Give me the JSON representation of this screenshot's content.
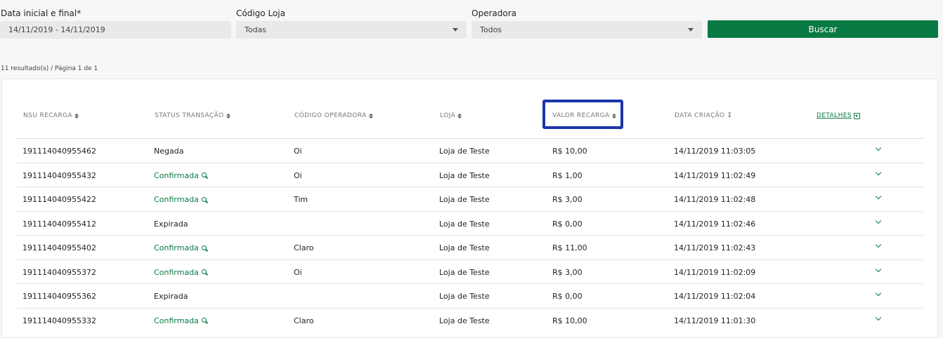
{
  "filters": {
    "date": {
      "label": "Data inicial e final*",
      "value": "14/11/2019 - 14/11/2019"
    },
    "store": {
      "label": "Código Loja",
      "value": "Todas"
    },
    "operator": {
      "label": "Operadora",
      "value": "Todos"
    },
    "search_label": "Buscar"
  },
  "results_text": "11 resultado(s) / Página 1 de 1",
  "table": {
    "headers": {
      "nsu": "NSU RECARGA",
      "status": "STATUS TRANSAÇÃO",
      "operator_code": "CÓDIGO OPERADORA",
      "store": "LOJA",
      "value": "VALOR RECARGA",
      "created": "DATA CRIAÇÃO",
      "details": "DETALHES"
    },
    "rows": [
      {
        "nsu": "191114040955462",
        "status": "Negada",
        "operator": "Oi",
        "store": "Loja de Teste",
        "value": "R$ 10,00",
        "created": "14/11/2019 11:03:05"
      },
      {
        "nsu": "191114040955432",
        "status": "Confirmada",
        "operator": "Oi",
        "store": "Loja de Teste",
        "value": "R$ 1,00",
        "created": "14/11/2019 11:02:49"
      },
      {
        "nsu": "191114040955422",
        "status": "Confirmada",
        "operator": "Tim",
        "store": "Loja de Teste",
        "value": "R$ 3,00",
        "created": "14/11/2019 11:02:48"
      },
      {
        "nsu": "191114040955412",
        "status": "Expirada",
        "operator": "",
        "store": "Loja de Teste",
        "value": "R$ 0,00",
        "created": "14/11/2019 11:02:46"
      },
      {
        "nsu": "191114040955402",
        "status": "Confirmada",
        "operator": "Claro",
        "store": "Loja de Teste",
        "value": "R$ 11,00",
        "created": "14/11/2019 11:02:43"
      },
      {
        "nsu": "191114040955372",
        "status": "Confirmada",
        "operator": "Oi",
        "store": "Loja de Teste",
        "value": "R$ 3,00",
        "created": "14/11/2019 11:02:09"
      },
      {
        "nsu": "191114040955362",
        "status": "Expirada",
        "operator": "",
        "store": "Loja de Teste",
        "value": "R$ 0,00",
        "created": "14/11/2019 11:02:04"
      },
      {
        "nsu": "191114040955332",
        "status": "Confirmada",
        "operator": "Claro",
        "store": "Loja de Teste",
        "value": "R$ 10,00",
        "created": "14/11/2019 11:01:30"
      }
    ]
  },
  "colors": {
    "accent": "#0a7a44",
    "highlight": "#1c36a8"
  }
}
